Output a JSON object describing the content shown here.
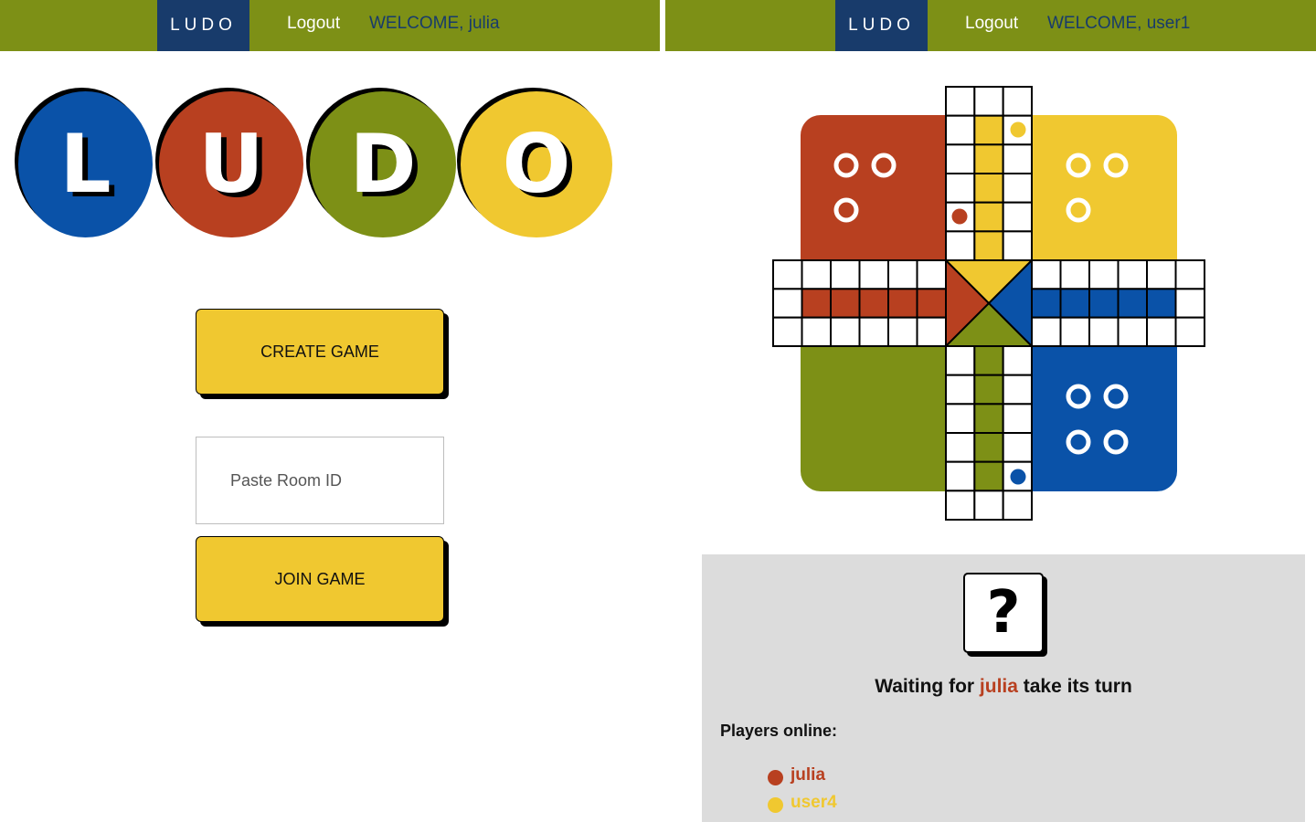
{
  "colors": {
    "nav_green": "#7d9016",
    "brand_navy": "#183b6b",
    "red": "#b84020",
    "green": "#7d9016",
    "yellow": "#f0c830",
    "blue": "#0a52a8",
    "panel_gray": "#dcdcdc"
  },
  "left": {
    "nav": {
      "brand": "LUDO",
      "logout": "Logout",
      "welcome": "WELCOME, julia"
    },
    "logo": {
      "letters": [
        {
          "char": "L",
          "color": "#0a52a8"
        },
        {
          "char": "U",
          "color": "#b84020"
        },
        {
          "char": "D",
          "color": "#7d9016"
        },
        {
          "char": "O",
          "color": "#f0c830"
        }
      ]
    },
    "create_button": "CREATE GAME",
    "room_input": {
      "placeholder": "Paste Room ID",
      "value": ""
    },
    "join_button": "JOIN GAME"
  },
  "right": {
    "nav": {
      "brand": "LUDO",
      "logout": "Logout",
      "welcome": "WELCOME, user1"
    },
    "board": {
      "homes": [
        {
          "color": "red",
          "pieces_in_home": 3
        },
        {
          "color": "yellow",
          "pieces_in_home": 3
        },
        {
          "color": "green",
          "pieces_in_home": 0
        },
        {
          "color": "blue",
          "pieces_in_home": 4
        }
      ],
      "pieces_on_track": [
        "yellow",
        "red",
        "blue"
      ]
    },
    "dice": {
      "face": "?"
    },
    "turn": {
      "prefix": "Waiting for ",
      "player": "julia",
      "suffix": " take its turn"
    },
    "players_title": "Players online:",
    "players": [
      {
        "name": "julia",
        "color": "#b84020"
      },
      {
        "name": "user4",
        "color": "#f0c830"
      }
    ]
  }
}
